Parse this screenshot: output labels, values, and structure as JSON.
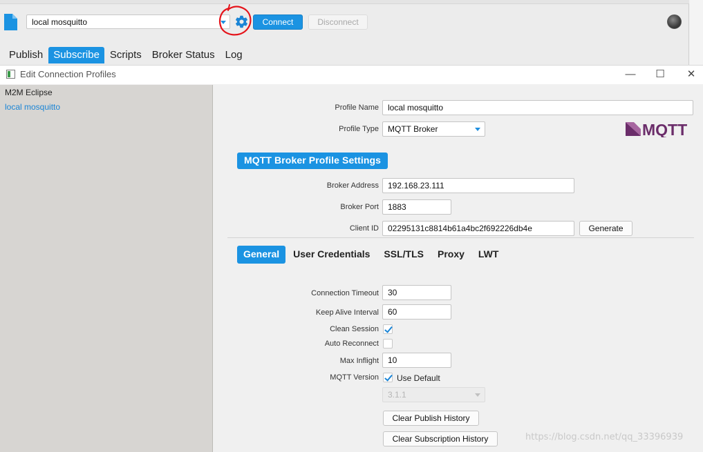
{
  "app": {
    "profile_selector": {
      "value": "local mosquitto"
    },
    "connect_label": "Connect",
    "disconnect_label": "Disconnect",
    "tabs": [
      {
        "label": "Publish",
        "active": false
      },
      {
        "label": "Subscribe",
        "active": true
      },
      {
        "label": "Scripts",
        "active": false
      },
      {
        "label": "Broker Status",
        "active": false
      },
      {
        "label": "Log",
        "active": false
      }
    ],
    "accent_color": "#1b93e2"
  },
  "dialog": {
    "title": "Edit Connection Profiles",
    "controls": {
      "minimize": "—",
      "maximize": "☐",
      "close": "✕"
    },
    "profiles": [
      {
        "label": "M2M Eclipse",
        "selected": false
      },
      {
        "label": "local mosquitto",
        "selected": true
      }
    ],
    "profile_name": {
      "label": "Profile Name",
      "value": "local mosquitto"
    },
    "profile_type": {
      "label": "Profile Type",
      "value": "MQTT Broker"
    },
    "logo_text": "MQTT",
    "section_title": "MQTT Broker Profile Settings",
    "broker_address": {
      "label": "Broker Address",
      "value": "192.168.23.111"
    },
    "broker_port": {
      "label": "Broker Port",
      "value": "1883"
    },
    "client_id": {
      "label": "Client ID",
      "value": "02295131c8814b61a4bc2f692226db4e"
    },
    "generate_label": "Generate",
    "subtabs": [
      {
        "label": "General",
        "active": true
      },
      {
        "label": "User Credentials",
        "active": false
      },
      {
        "label": "SSL/TLS",
        "active": false
      },
      {
        "label": "Proxy",
        "active": false
      },
      {
        "label": "LWT",
        "active": false
      }
    ],
    "general": {
      "connection_timeout": {
        "label": "Connection Timeout",
        "value": "30"
      },
      "keep_alive": {
        "label": "Keep Alive Interval",
        "value": "60"
      },
      "clean_session": {
        "label": "Clean Session",
        "checked": true
      },
      "auto_reconnect": {
        "label": "Auto Reconnect",
        "checked": false
      },
      "max_inflight": {
        "label": "Max Inflight",
        "value": "10"
      },
      "mqtt_version": {
        "label": "MQTT Version",
        "use_default_label": "Use Default",
        "checked": true,
        "version": "3.1.1"
      },
      "clear_publish_label": "Clear Publish History",
      "clear_subscription_label": "Clear Subscription History"
    }
  },
  "watermark": "https://blog.csdn.net/qq_33396939"
}
